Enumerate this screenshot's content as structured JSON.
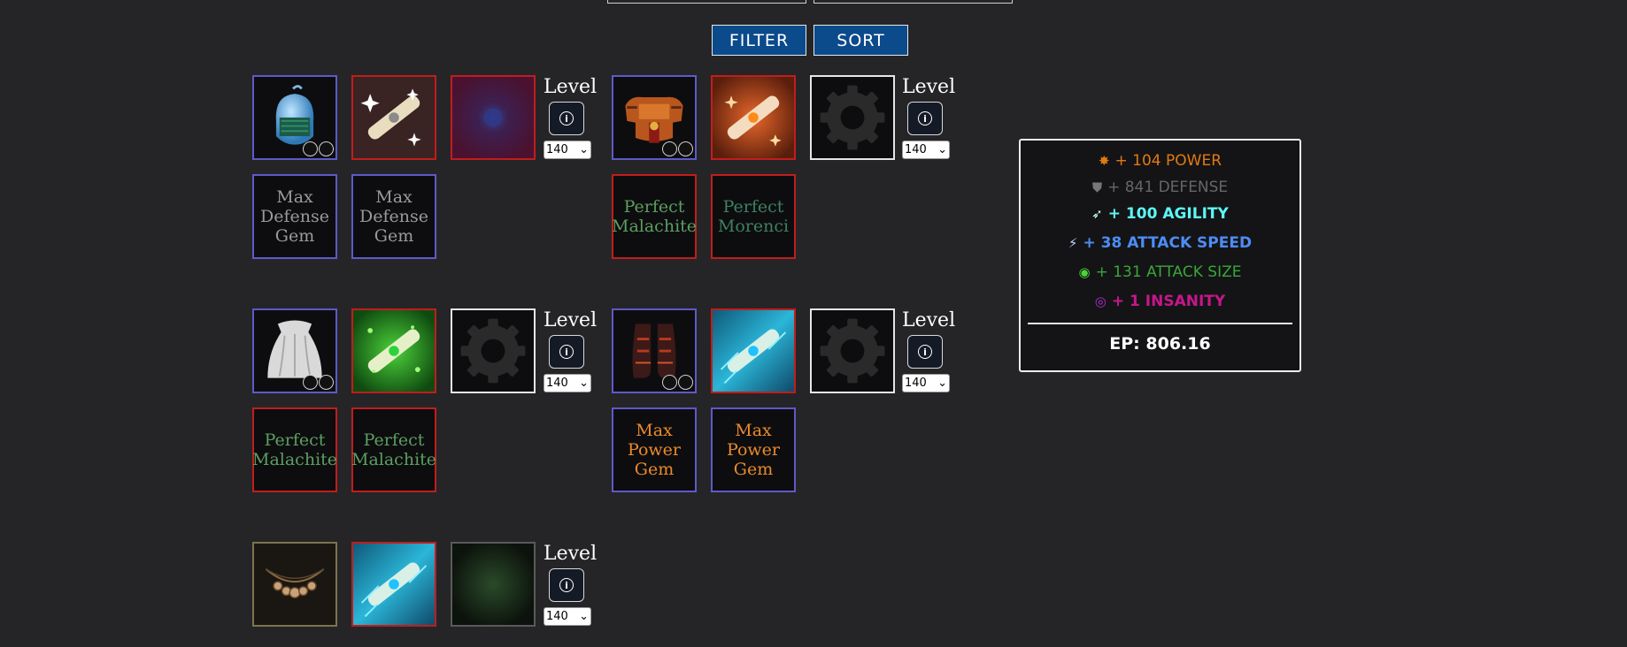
{
  "toolbar": {
    "filter_label": "FILTER",
    "sort_label": "SORT"
  },
  "level": {
    "label": "Level",
    "value": "140",
    "info_icon": "i"
  },
  "gear": [
    {
      "slot": "helmet",
      "item_icon": "knight-helmet-icon",
      "upgrade_icon": "white-scroll-icon",
      "extra_icon": "purple-orb-icon",
      "gems": [
        "Max Defense Gem",
        "Max Defense Gem"
      ]
    },
    {
      "slot": "chest",
      "item_icon": "armor-chest-icon",
      "upgrade_icon": "orange-scroll-icon",
      "extra_icon": "gear-icon",
      "gems": [
        "Perfect Malachite",
        "Perfect Morenci"
      ]
    },
    {
      "slot": "cape",
      "item_icon": "white-cape-icon",
      "upgrade_icon": "green-scroll-icon",
      "extra_icon": "gear-icon",
      "gems": [
        "Perfect Malachite",
        "Perfect Malachite"
      ]
    },
    {
      "slot": "boots",
      "item_icon": "red-boots-icon",
      "upgrade_icon": "blue-scroll-icon",
      "extra_icon": "gear-icon",
      "gems": [
        "Max Power Gem",
        "Max Power Gem"
      ]
    },
    {
      "slot": "necklace",
      "item_icon": "necklace-icon",
      "upgrade_icon": "blue-scroll-icon",
      "extra_icon": "green-orb-icon",
      "gems": []
    }
  ],
  "stats": {
    "power": {
      "text": "+ 104 POWER",
      "color": "#e27a12"
    },
    "defense": {
      "text": "+ 841 DEFENSE",
      "color": "#666666"
    },
    "agility": {
      "text": "+ 100 AGILITY",
      "color": "#5ef6f6"
    },
    "attack_speed": {
      "text": "+ 38 ATTACK SPEED",
      "color": "#4d8cf5"
    },
    "attack_size": {
      "text": "+ 131 ATTACK SIZE",
      "color": "#3aa63a"
    },
    "insanity": {
      "text": "+ 1 INSANITY",
      "color": "#c5178a"
    },
    "ep": "EP: 806.16"
  }
}
